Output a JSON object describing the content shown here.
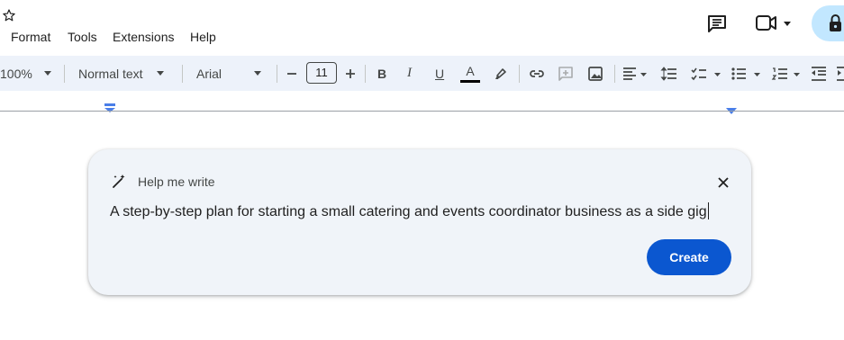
{
  "header": {
    "star_icon": "star-outline-icon",
    "menu": [
      "Format",
      "Tools",
      "Extensions",
      "Help"
    ],
    "comments_icon": "comments-icon",
    "meet_icon": "video-camera-icon",
    "share_icon": "lock-icon"
  },
  "toolbar": {
    "zoom": "100%",
    "style": "Normal text",
    "font": "Arial",
    "font_size": "11",
    "text_color": "#000000",
    "icons": [
      "minus-icon",
      "plus-icon",
      "bold-icon",
      "italic-icon",
      "underline-icon",
      "text-color-icon",
      "highlight-icon",
      "link-icon",
      "add-comment-icon",
      "image-icon",
      "align-icon",
      "line-spacing-icon",
      "checklist-icon",
      "bulleted-list-icon",
      "numbered-list-icon",
      "decrease-indent-icon"
    ],
    "bold_label": "B",
    "italic_label": "I",
    "underline_label": "U",
    "text_color_label": "A"
  },
  "help_panel": {
    "title": "Help me write",
    "prompt": "A step-by-step plan for starting a small catering and events coordinator business as a side gig",
    "create_label": "Create",
    "accent_color": "#0b57d0",
    "panel_color": "#f0f4f9"
  }
}
